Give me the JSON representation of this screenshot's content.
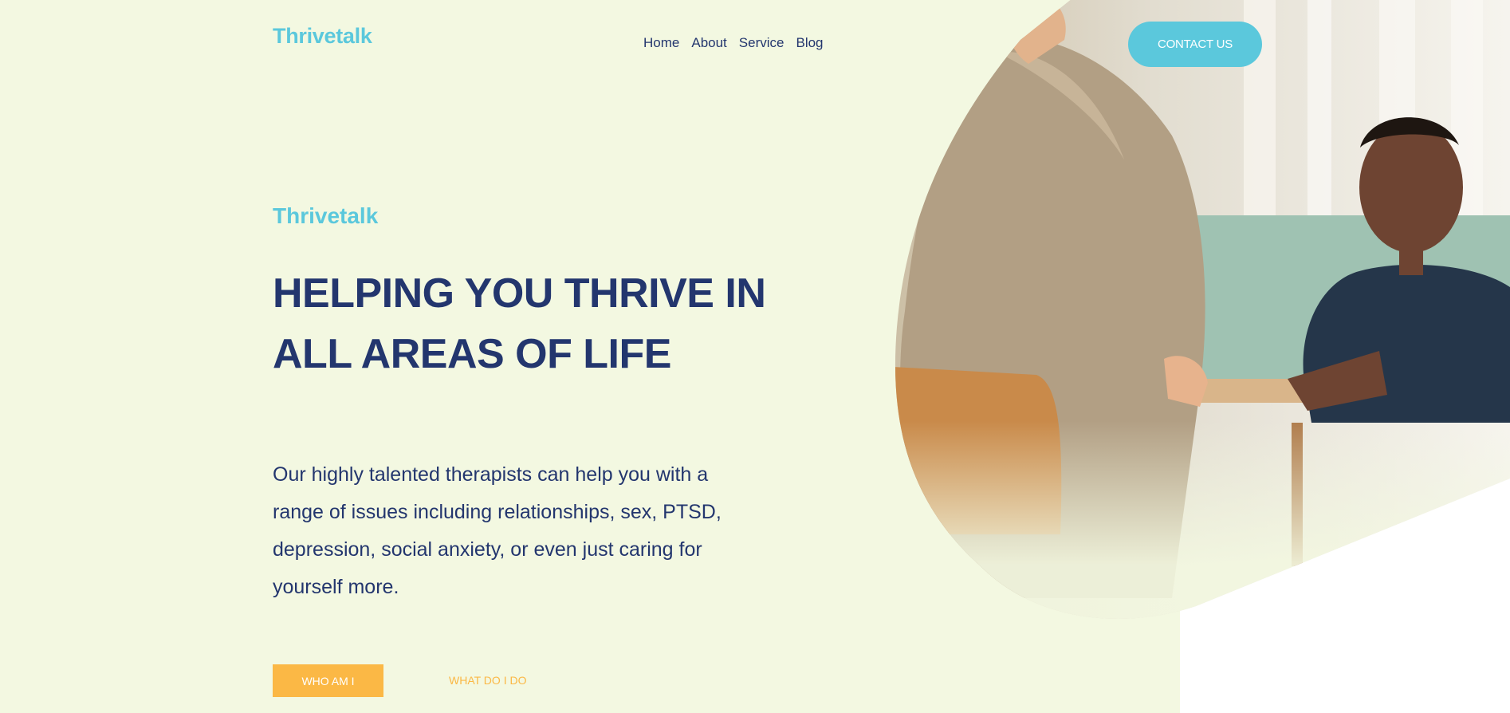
{
  "header": {
    "logo": "Thrivetalk",
    "nav": [
      "Home",
      "About",
      "Service",
      "Blog"
    ],
    "contact_label": "CONTACT US"
  },
  "hero": {
    "brand": "Thrivetalk",
    "headline": "HELPING YOU THRIVE IN ALL AREAS OF LIFE",
    "description": "Our highly talented therapists can help you with a range of issues including relationships, sex, PTSD, depression, social anxiety, or even just caring for yourself more.",
    "primary_cta": "WHO AM I",
    "secondary_cta": "WHAT DO I DO",
    "image": "therapy-session-photo"
  },
  "colors": {
    "background": "#f3f8e1",
    "accent": "#5bc8dc",
    "heading": "#23366e",
    "cta": "#fbb845"
  }
}
